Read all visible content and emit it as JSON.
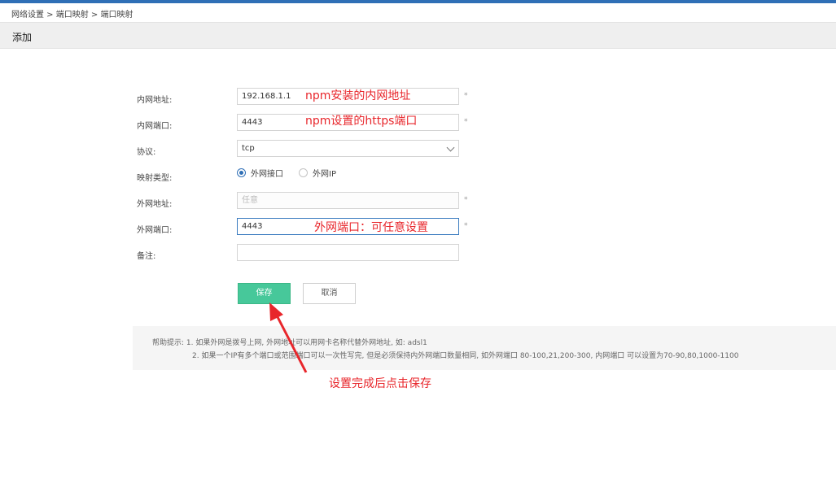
{
  "breadcrumb": "网络设置 > 端口映射 > 端口映射",
  "header": {
    "title": "添加"
  },
  "form": {
    "lan_addr": {
      "label": "内网地址:",
      "value": "192.168.1.1",
      "required": "*"
    },
    "lan_port": {
      "label": "内网端口:",
      "value": "4443",
      "required": "*"
    },
    "protocol": {
      "label": "协议:",
      "value": "tcp"
    },
    "map_type": {
      "label": "映射类型:",
      "option1": "外网接口",
      "option2": "外网IP",
      "selected": "外网接口"
    },
    "wan_addr": {
      "label": "外网地址:",
      "placeholder": "任意",
      "required": "*"
    },
    "wan_port": {
      "label": "外网端口:",
      "value": "4443",
      "required": "*"
    },
    "remark": {
      "label": "备注:",
      "value": ""
    }
  },
  "buttons": {
    "save": "保存",
    "cancel": "取消"
  },
  "help": {
    "line1": "帮助提示:  1. 如果外网是拨号上网, 外网地址可以用网卡名称代替外网地址, 如: adsl1",
    "line2": "2. 如果一个IP有多个端口或范围端口可以一次性写完, 但是必须保持内外网端口数量相同, 如外网端口 80-100,21,200-300, 内网端口 可以设置为70-90,80,1000-1100"
  },
  "annotations": {
    "lan_addr_note": "npm安装的内网地址",
    "lan_port_note": "npm设置的https端口",
    "wan_port_note": "外网端口：可任意设置",
    "save_note": "设置完成后点击保存"
  },
  "colors": {
    "accent": "#2f6fb6",
    "save_button": "#47c89a",
    "annotation": "#e8262b"
  }
}
